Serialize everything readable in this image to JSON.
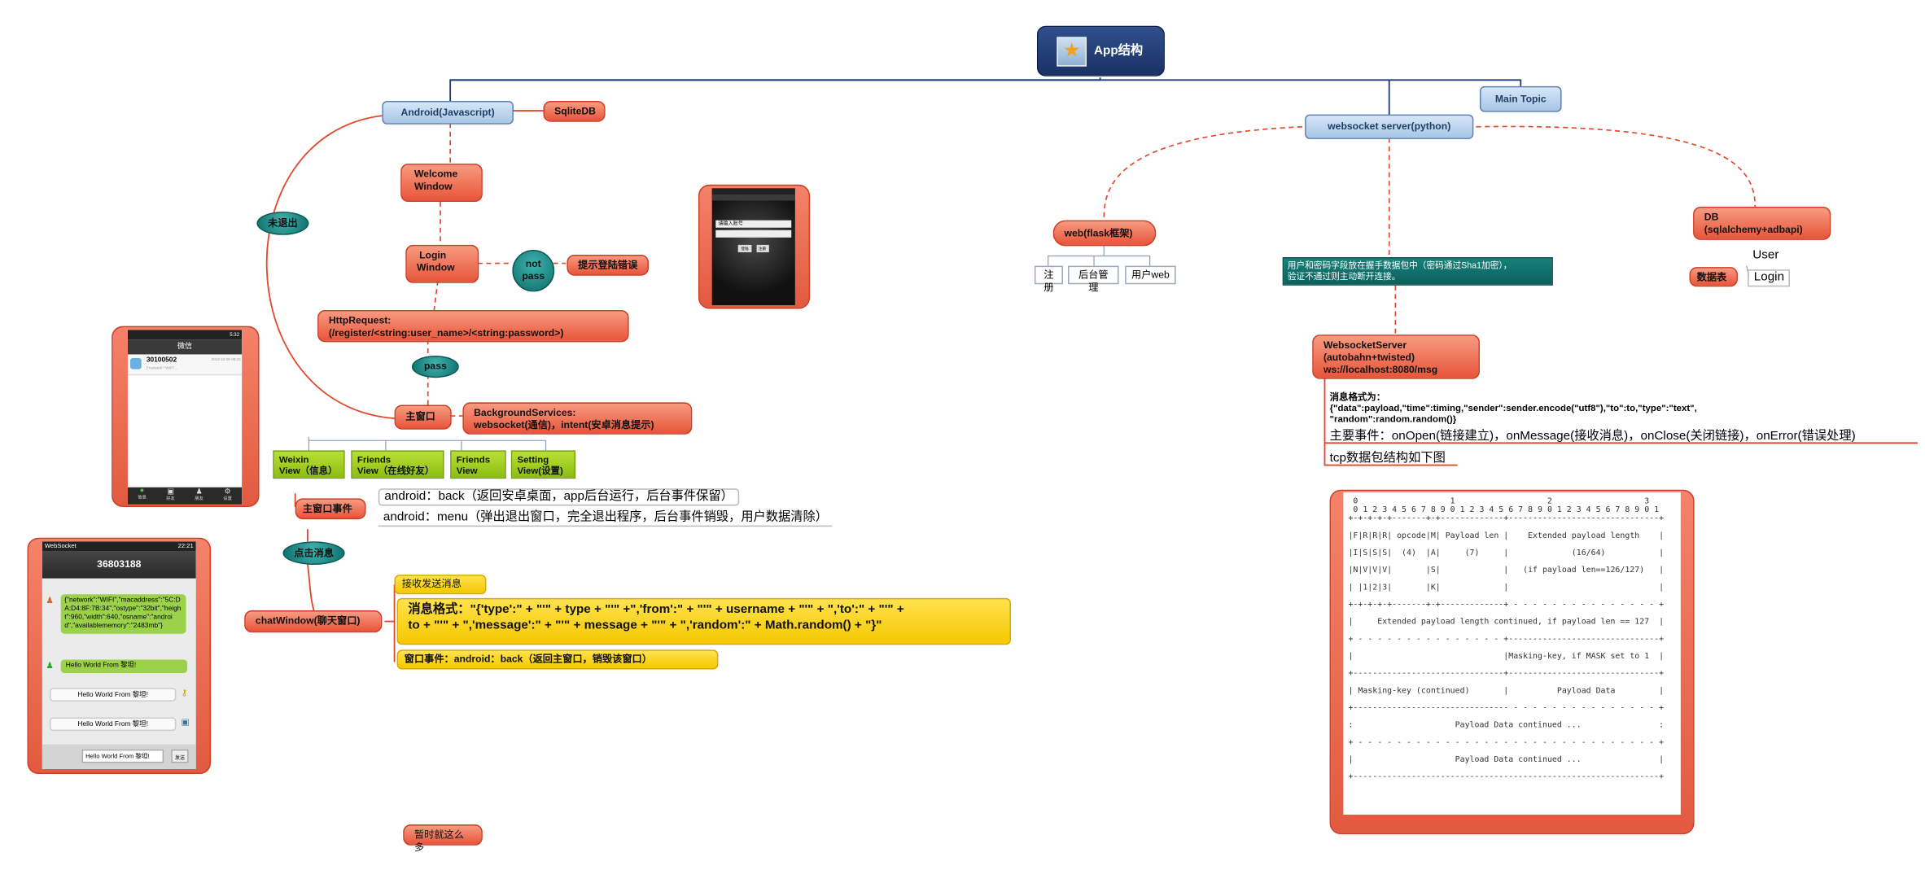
{
  "root": {
    "title": "App结构",
    "icon": "star-icon"
  },
  "main_topic": "Main Topic",
  "android": {
    "title": "Android(Javascript)",
    "sqlite": "SqliteDB",
    "welcome": [
      "Welcome",
      "Window"
    ],
    "login": [
      "Login",
      "Window"
    ],
    "not_pass": [
      "not",
      "pass"
    ],
    "login_error": "提示登陆错误",
    "http_request": [
      "HttpRequest:",
      "(/register/<string:user_name>/<string:password>)"
    ],
    "pass": "pass",
    "not_exit": "未退出",
    "main_window": "主窗口",
    "background_services": [
      "BackgroundServices:",
      "websocket(通信)，intent(安卓消息提示)"
    ],
    "views": [
      [
        "Weixin",
        "View（信息）"
      ],
      [
        "Friends",
        "View（在线好友）"
      ],
      [
        "Friends",
        "View"
      ],
      [
        "Setting",
        "View(设置)"
      ]
    ],
    "main_window_events": "主窗口事件",
    "back_event": "android：back（返回安卓桌面，app后台运行，后台事件保留）",
    "menu_event": "android：menu（弹出退出窗口，完全退出程序，后台事件销毁，用户数据清除）",
    "click_message": "点击消息",
    "chat_window": "chatWindow(聊天窗口)",
    "receive_send": "接收发送消息",
    "message_format": [
      "消息格式：\"{'type':\" + \"'\" + type + \"'\" +\",'from':\" + \"'\" + username + \"'\" + \",'to':\" + \"'\" +",
      "to + \"'\" + \",'message':\" + \"'\" + message + \"'\" + \",'random':\" + Math.random() + \"}\""
    ],
    "window_event": "窗口事件：android：back（返回主窗口，销毁该窗口）",
    "for_now": "暂时就这么多"
  },
  "server": {
    "title": "websocket server(python)",
    "web": "web(flask框架)",
    "web_children": [
      "注册",
      "后台管理",
      "用户web"
    ],
    "encryption_note": [
      "用户和密码字段放在握手数据包中（密码通过Sha1加密），",
      "验证不通过则主动断开连接。"
    ],
    "db": [
      "DB",
      "(sqlalchemy+adbapi)"
    ],
    "table_label": "数据表",
    "tables": [
      "User",
      "Login"
    ],
    "ws_server": [
      "WebsocketServer",
      "(autobahn+twisted)",
      "ws://localhost:8080/msg"
    ],
    "msg_format": [
      "消息格式为：",
      "{\"data\":payload,\"time\":timing,\"sender\":sender.encode(\"utf8\"),\"to\":to,\"type\":\"text\",",
      "\"random\":random.random()}"
    ],
    "events": "主要事件：onOpen(链接建立)，onMessage(接收消息)，onClose(关闭链接)，onError(错误处理)",
    "tcp": "tcp数据包结构如下图"
  },
  "packet_diagram": [
    " 0                   1                   2                   3",
    " 0 1 2 3 4 5 6 7 8 9 0 1 2 3 4 5 6 7 8 9 0 1 2 3 4 5 6 7 8 9 0 1",
    "+-+-+-+-+-------+-+-------------+-------------------------------+",
    "",
    "|F|R|R|R| opcode|M| Payload len |    Extended payload length    |",
    "",
    "|I|S|S|S|  (4)  |A|     (7)     |             (16/64)           |",
    "",
    "|N|V|V|V|       |S|             |   (if payload len==126/127)   |",
    "",
    "| |1|2|3|       |K|             |                               |",
    "",
    "+-+-+-+-+-------+-+-------------+ - - - - - - - - - - - - - - - +",
    "",
    "|     Extended payload length continued, if payload len == 127  |",
    "",
    "+ - - - - - - - - - - - - - - - +-------------------------------+",
    "",
    "|                               |Masking-key, if MASK set to 1  |",
    "",
    "+-------------------------------+-------------------------------+",
    "",
    "| Masking-key (continued)       |          Payload Data         |",
    "",
    "+-------------------------------- - - - - - - - - - - - - - - - +",
    "",
    ":                     Payload Data continued ...                :",
    "",
    "+ - - - - - - - - - - - - - - - - - - - - - - - - - - - - - - - +",
    "",
    "|                     Payload Data continued ...                |",
    "",
    "+---------------------------------------------------------------+"
  ],
  "phone_login": {
    "field1": "请输入账号",
    "field2": "",
    "btn1": "登陆",
    "btn2": "注册"
  },
  "phone_weixin": {
    "title": "微信",
    "time": "5:32",
    "contact": "30100502",
    "contact_time": "2013-10-08 09:32",
    "preview": "{\"network\":\"WIFI\"...",
    "tabs": [
      "信息",
      "好友",
      "朋友",
      "设置"
    ]
  },
  "phone_chat": {
    "app": "WebSocket",
    "time": "22:21",
    "title": "36803188",
    "json_msg": "{\"network\":\"WIFI\",\"macaddress\":\"5C:DA:D4:8F:7B:34\",\"ostype\":\"32bit\",\"height\":960,\"width\":640,\"osname\":\"android\",\"availablememory\":\"2483mb\"}",
    "msgs": [
      "Hello World From 黎坦!",
      "Hello World From 黎坦!",
      "Hello World From 黎坦!"
    ],
    "input": "Hello World From 黎坦!",
    "send": "发送"
  }
}
